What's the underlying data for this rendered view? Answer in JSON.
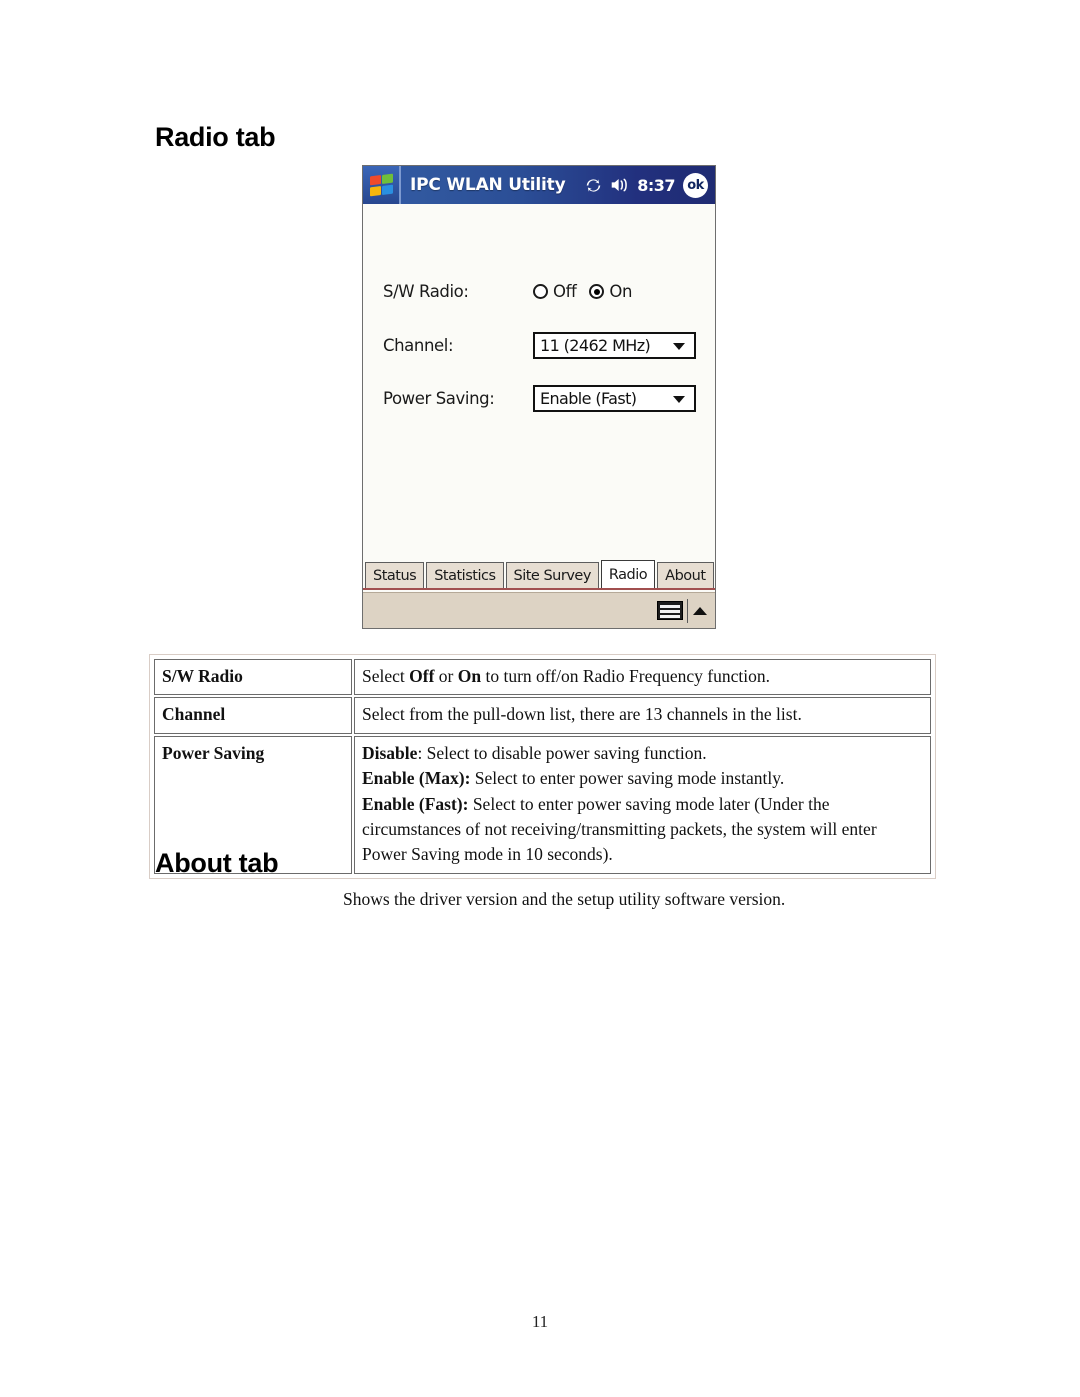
{
  "document": {
    "heading_radio": "Radio tab",
    "heading_about": "About tab",
    "about_description": "Shows the driver version and the setup utility software version.",
    "page_number": "11"
  },
  "pda": {
    "titlebar": {
      "start_logo": "windows-flag-icon",
      "app_title": "IPC WLAN Utility",
      "sync_icon": "sync-icon",
      "speaker_icon": "speaker-icon",
      "clock": "8:37",
      "ok_label": "ok",
      "gradient_start": "#2f58a8",
      "gradient_end": "#1f2b72"
    },
    "form": {
      "sw_radio": {
        "label": "S/W Radio:",
        "options": [
          "Off",
          "On"
        ],
        "selected": "On"
      },
      "channel": {
        "label": "Channel:",
        "value": "11 (2462 MHz)"
      },
      "power_saving": {
        "label": "Power Saving:",
        "value": "Enable (Fast)"
      }
    },
    "tabs": [
      {
        "label": "Status",
        "active": false
      },
      {
        "label": "Statistics",
        "active": false
      },
      {
        "label": "Site Survey",
        "active": false
      },
      {
        "label": "Radio",
        "active": true
      },
      {
        "label": "About",
        "active": false
      }
    ],
    "taskbar": {
      "keyboard_icon": "keyboard-icon",
      "sip-arrow": "sip-up-arrow-icon"
    },
    "screen_bg": "#fbfbf7",
    "tab_bg": "#e7ded2"
  },
  "table": {
    "rows": [
      {
        "term": "S/W Radio",
        "def_parts": [
          {
            "text": "Select ",
            "bold": false
          },
          {
            "text": "Off",
            "bold": true
          },
          {
            "text": " or ",
            "bold": false
          },
          {
            "text": "On",
            "bold": true
          },
          {
            "text": " to turn off/on Radio Frequency function.",
            "bold": false
          }
        ]
      },
      {
        "term": "Channel",
        "def_parts": [
          {
            "text": "Select from the pull-down list, there are 13 channels in the list.",
            "bold": false
          }
        ]
      },
      {
        "term": "Power Saving",
        "def_parts": [
          {
            "text": "Disable",
            "bold": true
          },
          {
            "text": ": Select to disable power saving function.",
            "bold": false
          },
          {
            "text": "\n",
            "bold": false
          },
          {
            "text": "Enable (Max):",
            "bold": true
          },
          {
            "text": " Select to enter power saving mode instantly.",
            "bold": false
          },
          {
            "text": "\n",
            "bold": false
          },
          {
            "text": "Enable (Fast):",
            "bold": true
          },
          {
            "text": " Select to enter power saving mode later (Under the circumstances of not receiving/transmitting packets, the system will enter Power Saving mode in 10 seconds).",
            "bold": false
          }
        ]
      }
    ]
  }
}
